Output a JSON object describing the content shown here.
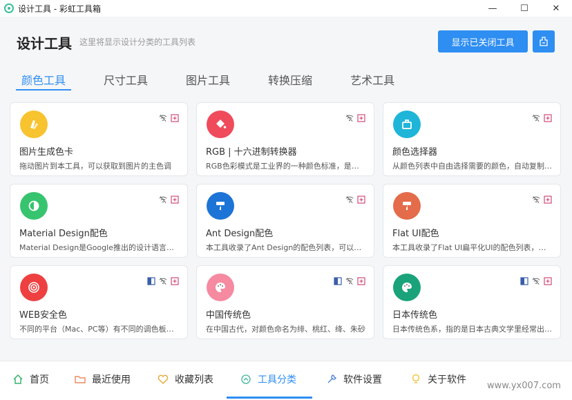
{
  "window": {
    "title": "设计工具 - 彩虹工具箱",
    "minimize": "—",
    "maximize": "☐",
    "close": "✕"
  },
  "header": {
    "title": "设计工具",
    "subtitle": "这里将显示设计分类的工具列表",
    "show_closed_button": "显示已关闭工具"
  },
  "tabs": [
    {
      "label": "颜色工具",
      "active": true
    },
    {
      "label": "尺寸工具",
      "active": false
    },
    {
      "label": "图片工具",
      "active": false
    },
    {
      "label": "转换压缩",
      "active": false
    },
    {
      "label": "艺术工具",
      "active": false
    }
  ],
  "cards": [
    {
      "title": "图片生成色卡",
      "desc": "拖动图片到本工具，可以获取到图片的主色调",
      "icon": "color-palette-icon",
      "color": "#f7c32e",
      "offline": true
    },
    {
      "title": "RGB | 十六进制转换器",
      "desc": "RGB色彩模式是工业界的一种颜色标准，是通过对红",
      "icon": "paint-bucket-icon",
      "color": "#ef4b5b",
      "offline": true
    },
    {
      "title": "颜色选择器",
      "desc": "从颜色列表中自由选择需要的颜色，自动复制色值",
      "icon": "color-picker-icon",
      "color": "#1eb5d9",
      "offline": true
    },
    {
      "title": "Material Design配色",
      "desc": "Material Design是Google推出的设计语言，这里",
      "icon": "contrast-icon",
      "color": "#37c46f",
      "offline": true
    },
    {
      "title": "Ant Design配色",
      "desc": "本工具收录了Ant Design的配色列表，可以直接",
      "icon": "paint-roller-icon",
      "color": "#1c74d6",
      "offline": true
    },
    {
      "title": "Flat UI配色",
      "desc": "本工具收录了Flat UI扁平化UI的配色列表，可以",
      "icon": "paint-roller-icon",
      "color": "#e46c4a",
      "offline": true
    },
    {
      "title": "WEB安全色",
      "desc": "不同的平台（Mac、PC等）有不同的调色板，不同的",
      "icon": "target-icon",
      "color": "#ee4040",
      "offline": true,
      "window": true
    },
    {
      "title": "中国传统色",
      "desc": "在中国古代，对颜色命名为绯、桃红、绛、朱砂",
      "icon": "palette-icon",
      "color": "#f58aa0",
      "offline": true,
      "window": true
    },
    {
      "title": "日本传统色",
      "desc": "日本传统色系，指的是日本古典文学里经常出现的",
      "icon": "palette-icon",
      "color": "#1aa37a",
      "offline": true,
      "window": true
    }
  ],
  "bottom_nav": [
    {
      "label": "首页",
      "icon": "home-icon",
      "active": false
    },
    {
      "label": "最近使用",
      "icon": "folder-icon",
      "active": false
    },
    {
      "label": "收藏列表",
      "icon": "heart-icon",
      "active": false
    },
    {
      "label": "工具分类",
      "icon": "category-icon",
      "active": true
    },
    {
      "label": "软件设置",
      "icon": "wrench-icon",
      "active": false
    },
    {
      "label": "关于软件",
      "icon": "bulb-icon",
      "active": false
    }
  ],
  "watermark": "www.yx007.com",
  "colors": {
    "accent": "#2e8ef2",
    "background": "#f5f6f8"
  }
}
